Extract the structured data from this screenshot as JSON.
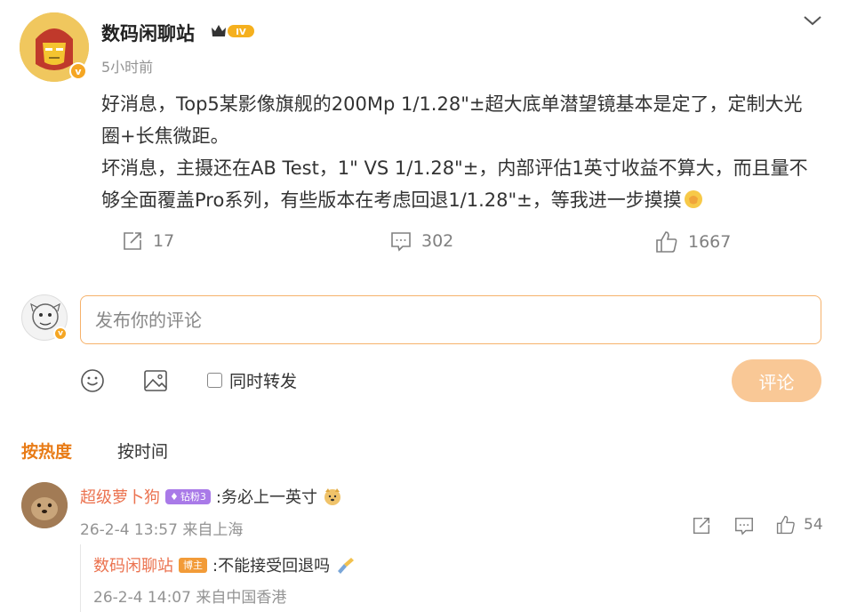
{
  "post": {
    "author": "数码闲聊站",
    "rank_badge": "IV",
    "verified_badge": "v",
    "time": "5小时前",
    "paragraphs": [
      "好消息，Top5某影像旗舰的200Mp 1/1.28\"±超大底单潜望镜基本是定了，定制大光圈+长焦微距。",
      "坏消息，主摄还在AB Test，1\" VS 1/1.28\"±，内部评估1英寸收益不算大，而且量不够全面覆盖Pro系列，有些版本在考虑回退1/1.28\"±，等我进一步摸摸"
    ],
    "emoji_icon": "fist-emoji",
    "reposts": "17",
    "comments": "302",
    "likes": "1667"
  },
  "composer": {
    "placeholder": "发布你的评论",
    "emoji_icon": "smiley-icon",
    "image_icon": "image-icon",
    "repost_checkbox_label": "同时转发",
    "submit_label": "评论"
  },
  "sort_tabs": {
    "hot": "按热度",
    "time": "按时间"
  },
  "comments": [
    {
      "user": "超级萝卜狗",
      "badge": "钻粉3",
      "text": ":务必上一英寸",
      "emoji": "doge-emoji",
      "meta": "26-2-4 13:57 来自上海",
      "likes": "54",
      "reply": {
        "user": "数码闲聊站",
        "badge": "博主",
        "text": ":不能接受回退吗",
        "emoji": "cheers-emoji",
        "meta": "26-2-4 14:07 来自中国香港"
      }
    }
  ],
  "colors": {
    "accent": "#e87b16",
    "username": "#eb7350",
    "submit": "#f9c896",
    "muted": "#939393"
  }
}
